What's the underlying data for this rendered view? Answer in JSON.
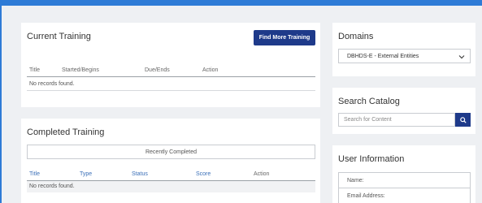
{
  "current_training": {
    "title": "Current Training",
    "find_more_button": "Find More Training",
    "columns": [
      "Title",
      "Started/Begins",
      "Due/Ends",
      "Action"
    ],
    "empty_message": "No records found."
  },
  "completed_training": {
    "title": "Completed Training",
    "filter_label": "Recently Completed",
    "columns": [
      "Title",
      "Type",
      "Status",
      "Score",
      "Action"
    ],
    "empty_message": "No records found."
  },
  "domains": {
    "title": "Domains",
    "selected": "DBHDS-E - External Entities"
  },
  "search_catalog": {
    "title": "Search Catalog",
    "placeholder": "Search for Content"
  },
  "user_information": {
    "title": "User Information",
    "fields": [
      "Name:",
      "Email Address:"
    ]
  },
  "colors": {
    "accent": "#2e7bd6",
    "button": "#1e3a8a",
    "column_header_blue": "#3a6fb8"
  },
  "icons": {
    "search": "search-icon",
    "dropdown": "chevron-down-icon"
  }
}
